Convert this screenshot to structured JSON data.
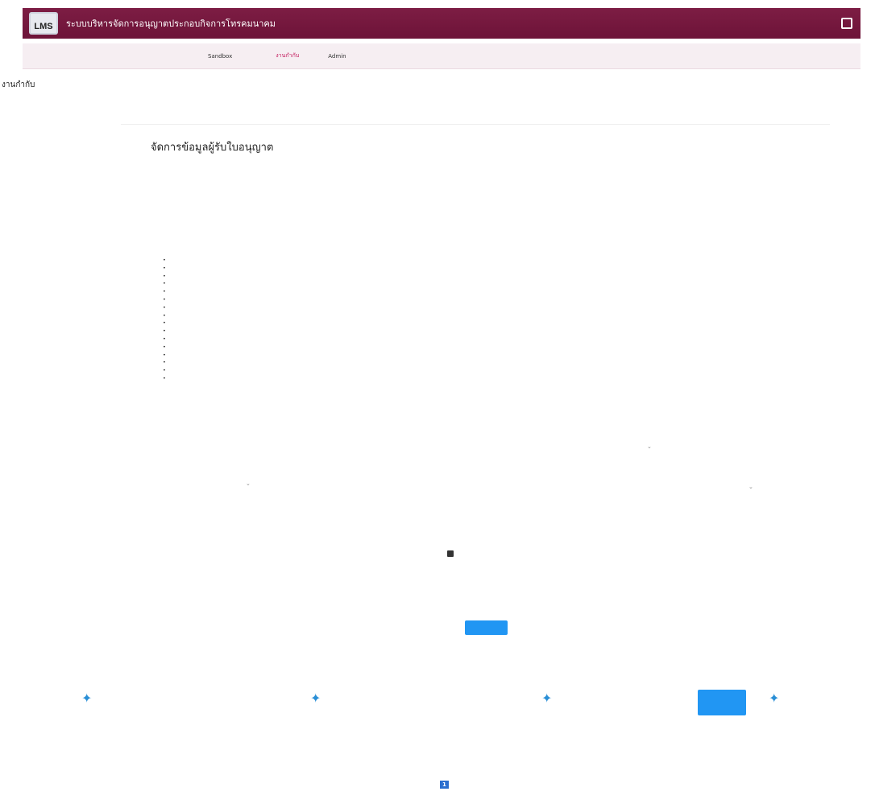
{
  "header": {
    "logo_text": "LMS",
    "app_title": "ระบบบริหารจัดการอนุญาตประกอบกิจการโทรคมนาคม",
    "user_name": ""
  },
  "nav": {
    "items": [
      {
        "label": ""
      },
      {
        "label": ""
      },
      {
        "label": ""
      },
      {
        "label": ""
      },
      {
        "label": "Sandbox"
      },
      {
        "label": ""
      },
      {
        "label": ""
      },
      {
        "label": "งานกำกับ",
        "active": true
      },
      {
        "label": ""
      },
      {
        "label": "Admin"
      },
      {
        "label": ""
      }
    ]
  },
  "sidebar": {
    "title": "งานกำกับ",
    "link": ""
  },
  "breadcrumb": "",
  "page_title": "จัดการข้อมูลผู้รับใบอนุญาต",
  "summary": {
    "reg_label": "",
    "reg_value": "",
    "holder_label": "",
    "holder_value": ""
  },
  "tabs": [
    {
      "label": "",
      "active": true
    },
    {
      "label": ""
    },
    {
      "label": ""
    },
    {
      "label": ""
    },
    {
      "label": ""
    },
    {
      "label": ""
    },
    {
      "label": ""
    },
    {
      "label": ""
    },
    {
      "label": ""
    }
  ],
  "info": {
    "heading": "",
    "rows": [
      {
        "label": "",
        "value": ""
      },
      {
        "label": "",
        "value": ""
      },
      {
        "label": "",
        "value": "",
        "link": ""
      },
      {
        "label": "",
        "value": ""
      },
      {
        "label": "",
        "value": ""
      },
      {
        "label": "",
        "value": "",
        "link": ""
      },
      {
        "label": "",
        "value": ""
      },
      {
        "label": "",
        "value": ""
      },
      {
        "label": "",
        "value": ""
      },
      {
        "label": "",
        "value": ""
      },
      {
        "label": "",
        "value": ""
      },
      {
        "label": "",
        "value": ""
      },
      {
        "label": "",
        "value": ""
      },
      {
        "label": "",
        "value": ""
      },
      {
        "label": "",
        "value": ""
      },
      {
        "label": "",
        "value": ""
      }
    ]
  },
  "form": {
    "reg_label": "",
    "reg_value": "",
    "branch_label": "",
    "branch_value": "",
    "prefix_label": "",
    "prefix_value": "",
    "name_th_label": "",
    "name_th_value": "",
    "suffix_label": "",
    "suffix_value": "",
    "name_en_label": "",
    "name_en_value": "",
    "reg_date_label": "",
    "reg_date_value": "",
    "field_a_label": "",
    "field_a_value": "",
    "field_b_label": "",
    "field_b_value": "",
    "purpose_label": "",
    "purpose_placeholder": "",
    "middle_button": "",
    "save_button": ""
  },
  "history": {
    "title": "",
    "columns": [
      "",
      "",
      "",
      "",
      "",
      "",
      ""
    ],
    "rows": [
      [
        "",
        "",
        "",
        "",
        "",
        "",
        ""
      ]
    ],
    "pager": {
      "first": "",
      "prev": "",
      "current": "1",
      "next": "",
      "last": ""
    },
    "total": ""
  },
  "colors": {
    "brand": "#7d1d44",
    "accent": "#c2185b",
    "button": "#2196f3",
    "tab_active": "#2b6fcf"
  }
}
